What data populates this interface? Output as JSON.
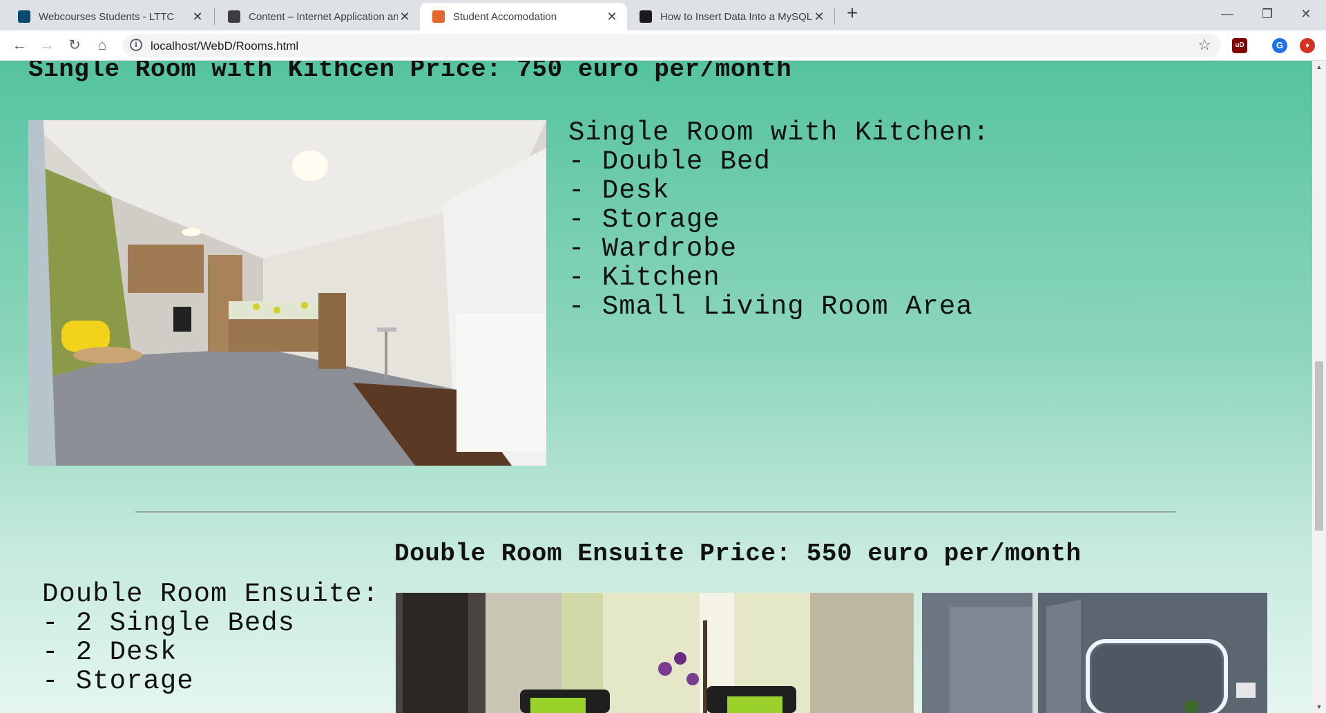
{
  "browser": {
    "tabs": [
      {
        "title": "Webcourses Students - LTTC",
        "favicon_color": "#0b4a6f",
        "active": false
      },
      {
        "title": "Content – Internet Application and",
        "favicon_color": "#3d3d3d",
        "active": false
      },
      {
        "title": "Student Accomodation",
        "favicon_color": "#e3662a",
        "active": true
      },
      {
        "title": "How to Insert Data Into a MySQL",
        "favicon_color": "#1a1a1a",
        "active": false
      }
    ],
    "url": "localhost/WebD/Rooms.html",
    "extensions": [
      {
        "name": "ublock-icon",
        "label": "uD",
        "color": "#800000"
      },
      {
        "name": "profile-avatar",
        "label": "G",
        "color": "#1a73e8"
      },
      {
        "name": "extension-red-icon",
        "label": "♦",
        "color": "#d93025"
      }
    ]
  },
  "page": {
    "single_room": {
      "heading": "Single Room with Kithcen Price: 750 euro per/month",
      "features": [
        "Single Room with Kitchen:",
        "- Double Bed",
        "- Desk",
        "- Storage",
        "- Wardrobe",
        "- Kitchen",
        "- Small Living Room Area"
      ]
    },
    "double_room": {
      "heading": "Double Room Ensuite Price: 550 euro per/month",
      "features": [
        "Double Room Ensuite:",
        "- 2 Single Beds",
        "- 2 Desk",
        "- Storage"
      ]
    }
  }
}
